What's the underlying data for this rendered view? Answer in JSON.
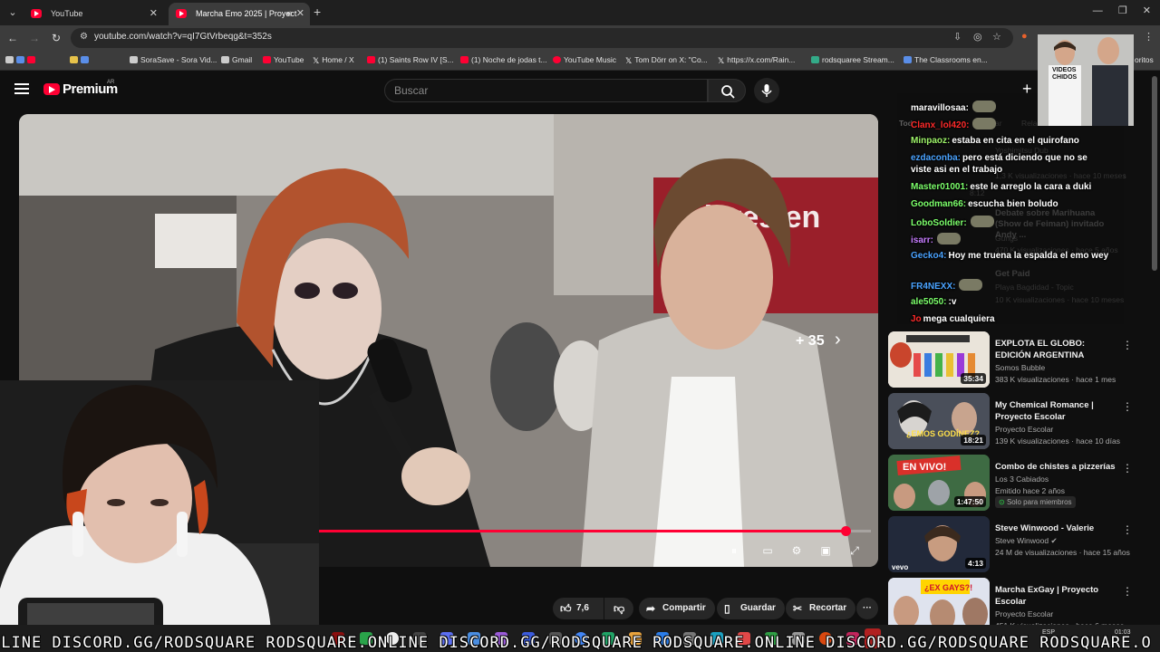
{
  "browser": {
    "tabs": [
      {
        "label": "YouTube"
      },
      {
        "label": "Marcha Emo 2025 | Proyect"
      }
    ],
    "url": "youtube.com/watch?v=qI7GtVrbeqg&t=352s",
    "bookmarks": [
      {
        "label": "SoraSave - Sora Vid...",
        "icon": "sora-icon"
      },
      {
        "label": "Gmail",
        "icon": "gmail-icon"
      },
      {
        "label": "YouTube",
        "icon": "youtube-icon"
      },
      {
        "label": "Home / X",
        "icon": "x-icon"
      },
      {
        "label": "(1) Saints Row IV [S...",
        "icon": "youtube-icon"
      },
      {
        "label": "(1) Noche de jodas t...",
        "icon": "youtube-icon"
      },
      {
        "label": "YouTube Music",
        "icon": "youtube-music-icon"
      },
      {
        "label": "Tom Dörr on X: \"Co...",
        "icon": "x-icon"
      },
      {
        "label": "https://x.com/Rain...",
        "icon": "x-icon"
      },
      {
        "label": "rodsquaree Stream...",
        "icon": "kick-icon"
      },
      {
        "label": "The Classrooms en...",
        "icon": "steam-icon"
      }
    ],
    "bookmarks_overflow": "oritos"
  },
  "youtube": {
    "brand": "Premium",
    "region": "AR",
    "search_placeholder": "Buscar"
  },
  "player": {
    "overlay_count": "+ 35",
    "progress_fraction": 0.96
  },
  "actions": {
    "like_count": "7,6 K",
    "share": "Compartir",
    "save": "Guardar",
    "clip": "Recortar"
  },
  "chat": [
    {
      "user": "maravillosaa:",
      "text": "",
      "color": "#ffffff",
      "emote": true
    },
    {
      "user": "Clanx_lol420:",
      "text": "",
      "color": "#ff2a2a",
      "emote": true
    },
    {
      "user": "Minpaoz:",
      "text": "estaba en cita en el quirofano",
      "color": "#9ff56a"
    },
    {
      "user": "ezdaconba:",
      "text": "pero está diciendo que no se viste asi en el trabajo",
      "color": "#4aa3ff"
    },
    {
      "user": "Master01001:",
      "text": "este le arreglo la cara a duki",
      "color": "#7cff6b"
    },
    {
      "user": "Goodman66:",
      "text": "escucha bien boludo",
      "color": "#7cff6b"
    },
    {
      "user": "LoboSoldier:",
      "text": "",
      "color": "#7cff6b",
      "emote": true
    },
    {
      "user": "isarr:",
      "text": "",
      "color": "#c77dff",
      "emote": true
    },
    {
      "user": "Gecko4:",
      "text": "Hoy me truena la espalda el emo wey",
      "color": "#4aa3ff"
    },
    {
      "user": "FR4NEXX:",
      "text": "",
      "color": "#4aa3ff",
      "emote": true
    },
    {
      "user": "ale5050:",
      "text": ":v",
      "color": "#7cff6b"
    },
    {
      "user": "Jo",
      "text": "mega cualquiera",
      "color": "#ff2a2a"
    }
  ],
  "ghost_entries": {
    "chip_all": "Tod",
    "chip_related": "Relac",
    "chip_mid": "ar",
    "g1_channel": "Yoshimitsu Dub",
    "g1_meta": "1,3 K visualizaciones · hace 10 meses",
    "g1_dur": "8:12",
    "g2_title": "Debate sobre Marihuana (Show de Feiman) invitado Andy ...",
    "g2_channel": "Gungs",
    "g2_meta": "470 K visualizaciones · hace 5 años",
    "g3_title": "Get Paid",
    "g3_channel": "Playa Bagdidad - Topic",
    "g3_meta": "10 K visualizaciones · hace 10 meses",
    "g3_dur": "5:42"
  },
  "sidebar": [
    {
      "title": "EXPLOTA EL GLOBO: EDICIÓN ARGENTINA",
      "channel": "Somos Bubble",
      "meta": "383 K visualizaciones · hace 1 mes",
      "duration": "35:34"
    },
    {
      "title": "My Chemical Romance | Proyecto Escolar",
      "channel": "Proyecto Escolar",
      "meta": "139 K visualizaciones · hace 10 días",
      "duration": "18:21"
    },
    {
      "title": "Combo de chistes a pizzerías",
      "channel": "Los 3 Cabiados",
      "meta": "Emitido hace 2 años",
      "duration": "1:47:50",
      "badge": "Solo para miembros"
    },
    {
      "title": "Steve Winwood - Valerie",
      "channel": "Steve Winwood",
      "meta": "24 M de visualizaciones · hace 15 años",
      "duration": "4:13",
      "thumb_label": "vevo"
    },
    {
      "title": "Marcha ExGay | Proyecto Escolar",
      "channel": "Proyecto Escolar",
      "meta": "451 K visualizaciones · hace 6 meses"
    }
  ],
  "thumb_text": {
    "emos": "¿EMOS GODÍNEZ?",
    "envivo": "EN VIVO!",
    "exgays": "¿EX GAYS?!"
  },
  "webcam2": {
    "label": "VIDEOS CHIDOS"
  },
  "ticker": "NLINE DISCORD.GG/RODSQUARE RODSQUARE.ONLINE DISCORD.GG/RODSQUARE RODSQUARE.ONLINE DISCORD.GG/RODSQUARE RODSQUARE.O",
  "taskbar": {
    "lang": "ESP",
    "time": "01:03"
  },
  "colors": {
    "accent": "#ff0033",
    "background": "#0f0f0f"
  }
}
